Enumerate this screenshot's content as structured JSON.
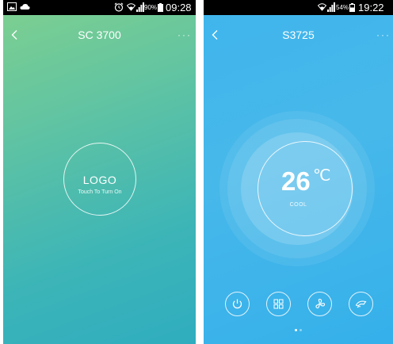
{
  "left_screen": {
    "status": {
      "battery": "90%",
      "time": "09:28"
    },
    "title": "SC 3700",
    "logo": {
      "label": "LOGO",
      "hint": "Touch To Turn On"
    }
  },
  "right_screen": {
    "status": {
      "battery": "54%",
      "time": "19:22"
    },
    "title": "S3725",
    "temperature": "26",
    "unit": "℃",
    "mode": "COOL",
    "controls": [
      "power-icon",
      "mode-grid-icon",
      "fan-icon",
      "swing-icon"
    ],
    "pager": {
      "pages": 2,
      "active": 1
    }
  },
  "colors": {
    "left_gradient": [
      "#7fd08f",
      "#2fadbf"
    ],
    "right_gradient": [
      "#3fb5ec",
      "#35b0ea"
    ]
  }
}
